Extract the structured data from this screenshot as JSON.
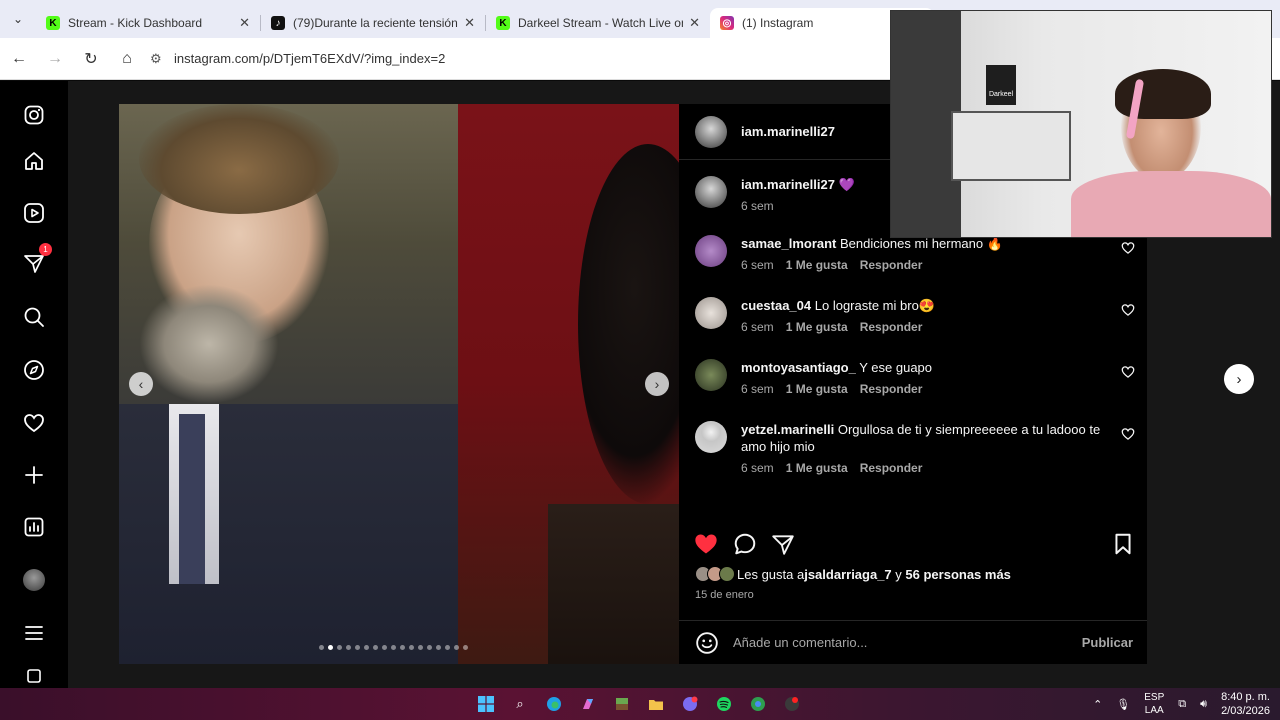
{
  "browser": {
    "tabs": [
      {
        "title": "Stream - Kick Dashboard",
        "favicon": "K",
        "favicon_color": "#53fc18",
        "active": false
      },
      {
        "title": "(79)Durante la reciente tensión",
        "favicon": "♪",
        "favicon_color": "#111111",
        "active": false
      },
      {
        "title": "Darkeel Stream - Watch Live on",
        "favicon": "K",
        "favicon_color": "#53fc18",
        "active": false
      },
      {
        "title": "(1) Instagram",
        "favicon": "◎",
        "favicon_color": "#e1306c",
        "active": true
      }
    ],
    "url": "instagram.com/p/DTjemT6EXdV/?img_index=2"
  },
  "sidebar": {
    "notifications_badge": "1",
    "items": [
      "instagram-logo-icon",
      "home-icon",
      "reels-icon",
      "messages-icon",
      "search-icon",
      "explore-icon",
      "notifications-icon",
      "create-icon",
      "dashboard-icon",
      "profile-icon",
      "more-icon"
    ]
  },
  "post": {
    "author": "iam.marinelli27",
    "caption_author": "iam.marinelli27",
    "caption_emoji": "💜",
    "caption_time": "6 sem",
    "carousel_total": 17,
    "carousel_active": 2,
    "comments": [
      {
        "user": "samae_lmorant",
        "text": "Bendiciones mi hermano 🔥",
        "time": "6 sem",
        "likes": "1 Me gusta",
        "reply": "Responder",
        "avatar_color": "#8a6a9a"
      },
      {
        "user": "cuestaa_04",
        "text": "Lo lograste mi bro😍",
        "time": "6 sem",
        "likes": "1 Me gusta",
        "reply": "Responder",
        "avatar_color": "#c9c2bd"
      },
      {
        "user": "montoyasantiago_",
        "text": "Y ese guapo",
        "time": "6 sem",
        "likes": "1 Me gusta",
        "reply": "Responder",
        "avatar_color": "#4a5a3a"
      },
      {
        "user": "yetzel.marinelli",
        "text": "Orgullosa de ti y siempreeeeee a tu ladooo te amo hijo mio",
        "time": "6 sem",
        "likes": "1 Me gusta",
        "reply": "Responder",
        "avatar_color": "#dbdbdb"
      }
    ],
    "likes_prefix": "Les gusta a ",
    "likes_user": "jsaldarriaga_7",
    "likes_suffix": " y ",
    "likes_others": "56 personas más",
    "date": "15 de enero",
    "comment_placeholder": "Añade un comentario...",
    "publish": "Publicar"
  },
  "webcam": {
    "label": "Darkeel"
  },
  "taskbar": {
    "lang_top": "ESP",
    "lang_bottom": "LAA",
    "time": "8:40 p. m.",
    "date": "2/03/2026"
  }
}
